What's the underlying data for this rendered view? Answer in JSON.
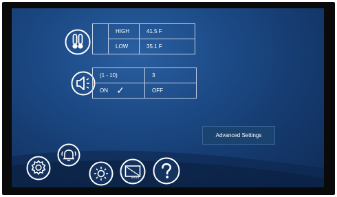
{
  "temperature": {
    "icon": "thermometer-icon",
    "rows": [
      {
        "label": "HIGH",
        "value": "41.5 F"
      },
      {
        "label": "LOW",
        "value": "35.1 F"
      }
    ]
  },
  "volume": {
    "icon": "speaker-icon",
    "range_label": "(1 - 10)",
    "level": "3",
    "on_label": "ON",
    "on_checked": "✓",
    "off_label": "OFF"
  },
  "advanced_button": {
    "label": "Advanced Settings"
  },
  "bottom_icons": [
    "settings-gear-icon",
    "alarm-bell-icon",
    "brightness-icon",
    "display-icon",
    "help-icon"
  ],
  "colors": {
    "screen_bg": "#1c4a86",
    "line": "#c7d2e3"
  }
}
